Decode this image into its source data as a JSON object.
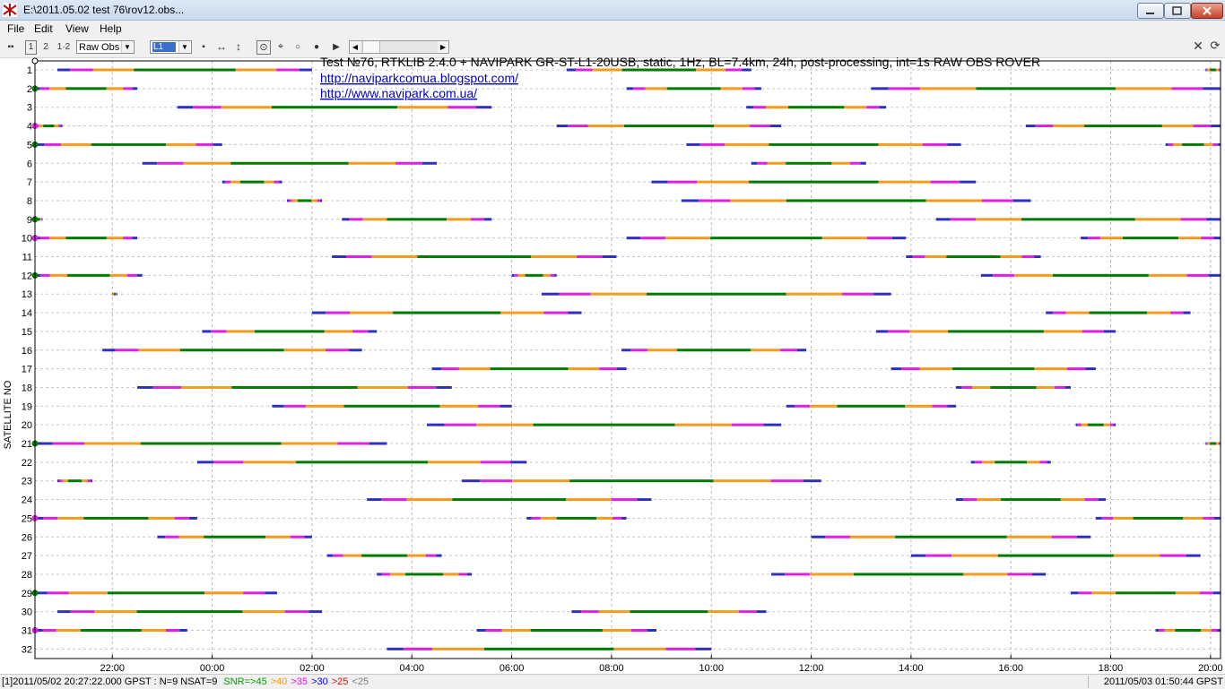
{
  "window": {
    "title": "E:\\2011.05.02 test 76\\rov12.obs..."
  },
  "menu": [
    "File",
    "Edit",
    "View",
    "Help"
  ],
  "toolbar": {
    "one": "1",
    "two": "1·2",
    "obs_type": "Raw Obs",
    "band": "L1"
  },
  "status": {
    "prefix": "[1]2011/05/02 20:27:22.000 GPST : N=9 NSAT=9",
    "snr_legend": [
      {
        "label": "SNR=>45",
        "color": "#00a000"
      },
      {
        "label": ">40",
        "color": "#ff9c00"
      },
      {
        "label": ">35",
        "color": "#ff00ff"
      },
      {
        "label": ">30",
        "color": "#0000ff"
      },
      {
        "label": ">25",
        "color": "#ff0000"
      },
      {
        "label": "<25",
        "color": "#808080"
      }
    ],
    "right": "2011/05/03 01:50:44 GPST"
  },
  "chart_data": {
    "type": "timeline",
    "title": "Test №76, RTKLIB 2.4.0 + NAVIPARK GR-ST-L1-20USB, static, 1Hz, BL=7.4km, 24h, post-processing, int=1s  RAW OBS ROVER",
    "links": [
      "http://naviparkcomua.blogspot.com/",
      "http://www.navipark.com.ua/"
    ],
    "ylabel": "SATELLITE NO",
    "xlabel": "",
    "x_ticks": [
      "22:00",
      "00:00",
      "02:00",
      "04:00",
      "06:00",
      "08:00",
      "10:00",
      "12:00",
      "14:00",
      "16:00",
      "18:00",
      "20:00"
    ],
    "x_range_hours": [
      20.45,
      44.2
    ],
    "first_tick_hours": 22,
    "y_ticks": [
      1,
      2,
      3,
      4,
      5,
      6,
      7,
      8,
      9,
      10,
      11,
      12,
      13,
      14,
      15,
      16,
      17,
      18,
      19,
      20,
      21,
      22,
      23,
      24,
      25,
      26,
      27,
      28,
      29,
      30,
      31,
      32
    ],
    "grid": true,
    "colors": {
      "high": "#007a00",
      "mid": "#f39c1f",
      "low": "#e020e0",
      "weak": "#3030c0",
      "poor": "#b03030",
      "bad": "#888888"
    },
    "series": [
      {
        "sat": 1,
        "passes": [
          [
            20.9,
            26.0
          ],
          [
            31.1,
            34.8
          ],
          [
            43.9,
            44.2
          ]
        ]
      },
      {
        "sat": 2,
        "passes": [
          [
            20.45,
            22.5
          ],
          [
            32.3,
            35.0
          ],
          [
            37.2,
            44.2
          ]
        ]
      },
      {
        "sat": 3,
        "passes": [
          [
            23.3,
            29.6
          ],
          [
            34.7,
            37.5
          ]
        ]
      },
      {
        "sat": 4,
        "passes": [
          [
            20.45,
            21.0
          ],
          [
            30.9,
            35.4
          ],
          [
            40.3,
            44.2
          ]
        ]
      },
      {
        "sat": 5,
        "passes": [
          [
            20.45,
            24.2
          ],
          [
            33.5,
            39.0
          ],
          [
            43.1,
            44.2
          ]
        ]
      },
      {
        "sat": 6,
        "passes": [
          [
            22.6,
            28.5
          ],
          [
            34.8,
            37.1
          ]
        ]
      },
      {
        "sat": 7,
        "passes": [
          [
            24.2,
            25.4
          ],
          [
            32.8,
            39.3
          ]
        ]
      },
      {
        "sat": 8,
        "passes": [
          [
            25.5,
            26.2
          ],
          [
            33.4,
            40.4
          ]
        ]
      },
      {
        "sat": 9,
        "passes": [
          [
            20.45,
            20.6
          ],
          [
            26.6,
            29.6
          ],
          [
            38.5,
            44.2
          ]
        ]
      },
      {
        "sat": 10,
        "passes": [
          [
            20.45,
            22.5
          ],
          [
            32.3,
            37.9
          ],
          [
            41.4,
            44.2
          ]
        ]
      },
      {
        "sat": 11,
        "passes": [
          [
            26.4,
            32.1
          ],
          [
            37.9,
            40.6
          ]
        ]
      },
      {
        "sat": 12,
        "passes": [
          [
            20.45,
            22.6
          ],
          [
            30.0,
            30.9
          ],
          [
            39.4,
            44.2
          ]
        ]
      },
      {
        "sat": 13,
        "passes": [
          [
            22.0,
            22.1
          ],
          [
            30.6,
            37.6
          ]
        ]
      },
      {
        "sat": 14,
        "passes": [
          [
            26.0,
            31.4
          ],
          [
            40.7,
            43.6
          ]
        ]
      },
      {
        "sat": 15,
        "passes": [
          [
            23.8,
            27.3
          ],
          [
            37.3,
            42.1
          ]
        ]
      },
      {
        "sat": 16,
        "passes": [
          [
            21.8,
            27.0
          ],
          [
            32.2,
            35.9
          ]
        ]
      },
      {
        "sat": 17,
        "passes": [
          [
            28.4,
            32.3
          ],
          [
            37.6,
            41.7
          ]
        ]
      },
      {
        "sat": 18,
        "passes": [
          [
            22.5,
            28.8
          ],
          [
            38.9,
            41.2
          ]
        ]
      },
      {
        "sat": 19,
        "passes": [
          [
            25.2,
            30.0
          ],
          [
            35.5,
            38.9
          ]
        ]
      },
      {
        "sat": 20,
        "passes": [
          [
            28.3,
            35.4
          ],
          [
            41.3,
            42.1
          ]
        ]
      },
      {
        "sat": 21,
        "passes": [
          [
            20.45,
            27.5
          ],
          [
            43.9,
            44.2
          ]
        ]
      },
      {
        "sat": 22,
        "passes": [
          [
            23.7,
            30.3
          ],
          [
            39.2,
            40.8
          ]
        ]
      },
      {
        "sat": 23,
        "passes": [
          [
            20.9,
            21.6
          ],
          [
            29.0,
            36.2
          ]
        ]
      },
      {
        "sat": 24,
        "passes": [
          [
            27.1,
            32.8
          ],
          [
            38.9,
            41.9
          ]
        ]
      },
      {
        "sat": 25,
        "passes": [
          [
            20.45,
            23.7
          ],
          [
            30.3,
            32.3
          ],
          [
            41.7,
            44.2
          ]
        ]
      },
      {
        "sat": 26,
        "passes": [
          [
            22.9,
            26.0
          ],
          [
            36.0,
            41.6
          ]
        ]
      },
      {
        "sat": 27,
        "passes": [
          [
            26.3,
            28.6
          ],
          [
            38.0,
            43.8
          ]
        ]
      },
      {
        "sat": 28,
        "passes": [
          [
            27.3,
            29.2
          ],
          [
            35.2,
            40.7
          ]
        ]
      },
      {
        "sat": 29,
        "passes": [
          [
            20.45,
            25.3
          ],
          [
            41.2,
            44.2
          ]
        ]
      },
      {
        "sat": 30,
        "passes": [
          [
            20.9,
            26.2
          ],
          [
            31.2,
            35.1
          ]
        ]
      },
      {
        "sat": 31,
        "passes": [
          [
            20.45,
            23.5
          ],
          [
            29.3,
            32.9
          ],
          [
            42.9,
            44.2
          ]
        ]
      },
      {
        "sat": 32,
        "passes": [
          [
            27.5,
            34.0
          ]
        ]
      }
    ]
  }
}
